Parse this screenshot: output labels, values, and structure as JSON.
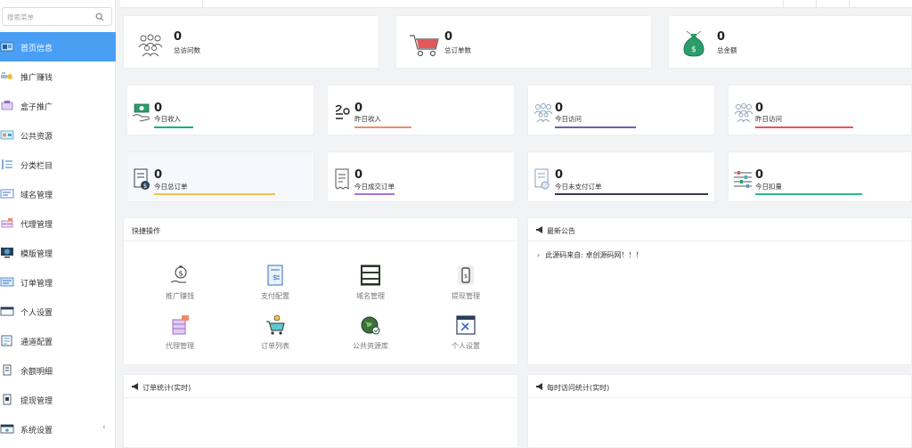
{
  "sidebar": {
    "search_placeholder": "搜索菜单",
    "items": [
      {
        "label": "首页信息",
        "icon": "dashboard-icon",
        "active": true
      },
      {
        "label": "推广赚钱",
        "icon": "promote-icon"
      },
      {
        "label": "盒子推广",
        "icon": "box-promote-icon"
      },
      {
        "label": "公共资源",
        "icon": "public-resource-icon"
      },
      {
        "label": "分类栏目",
        "icon": "category-icon"
      },
      {
        "label": "域名管理",
        "icon": "domain-icon"
      },
      {
        "label": "代理管理",
        "icon": "agent-icon"
      },
      {
        "label": "模版管理",
        "icon": "template-icon"
      },
      {
        "label": "订单管理",
        "icon": "order-icon"
      },
      {
        "label": "个人设置",
        "icon": "profile-icon"
      },
      {
        "label": "通道配置",
        "icon": "channel-icon"
      },
      {
        "label": "余额明细",
        "icon": "balance-icon"
      },
      {
        "label": "提现管理",
        "icon": "withdraw-icon"
      },
      {
        "label": "系统设置",
        "icon": "settings-icon",
        "chevron": "‹"
      }
    ]
  },
  "stats_top": [
    {
      "value": "0",
      "label": "总访问数",
      "icon": "visitors-icon"
    },
    {
      "value": "0",
      "label": "总订单数",
      "icon": "cart-icon"
    },
    {
      "value": "0",
      "label": "总金额",
      "icon": "money-bag-icon"
    }
  ],
  "stats_mid": [
    {
      "value": "0",
      "label": "今日收入",
      "color": "#1aaf82"
    },
    {
      "value": "0",
      "label": "昨日收入",
      "color": "#f08a6a"
    },
    {
      "value": "0",
      "label": "今日访问",
      "color": "#6a5fb8"
    },
    {
      "value": "0",
      "label": "昨日访问",
      "color": "#e8555a"
    }
  ],
  "stats_low": [
    {
      "value": "0",
      "label": "今日总订单",
      "color": "#f3c34a"
    },
    {
      "value": "0",
      "label": "今日成交订单",
      "color": "#a972d6"
    },
    {
      "value": "0",
      "label": "今日未支付订单",
      "color": "#333b55"
    },
    {
      "value": "0",
      "label": "今日扣量",
      "color": "#2ab98a"
    }
  ],
  "quick": {
    "title": "快捷操作",
    "items": [
      {
        "label": "推广赚钱",
        "icon": "money-hand-icon"
      },
      {
        "label": "支付配置",
        "icon": "payment-doc-icon"
      },
      {
        "label": "域名管理",
        "icon": "domain-board-icon"
      },
      {
        "label": "提现管理",
        "icon": "phone-money-icon"
      },
      {
        "label": "代理管理",
        "icon": "server-icon"
      },
      {
        "label": "订单列表",
        "icon": "cart-list-icon"
      },
      {
        "label": "公共资源库",
        "icon": "globe-icon"
      },
      {
        "label": "个人设置",
        "icon": "tools-window-icon"
      }
    ]
  },
  "notice": {
    "title": "最新公告",
    "items": [
      {
        "text": "此源码来自: 卓创源码网！！！"
      }
    ]
  },
  "order_stats": {
    "title": "订单统计(实时)"
  },
  "visit_stats": {
    "title": "每时访问统计(实时)"
  }
}
